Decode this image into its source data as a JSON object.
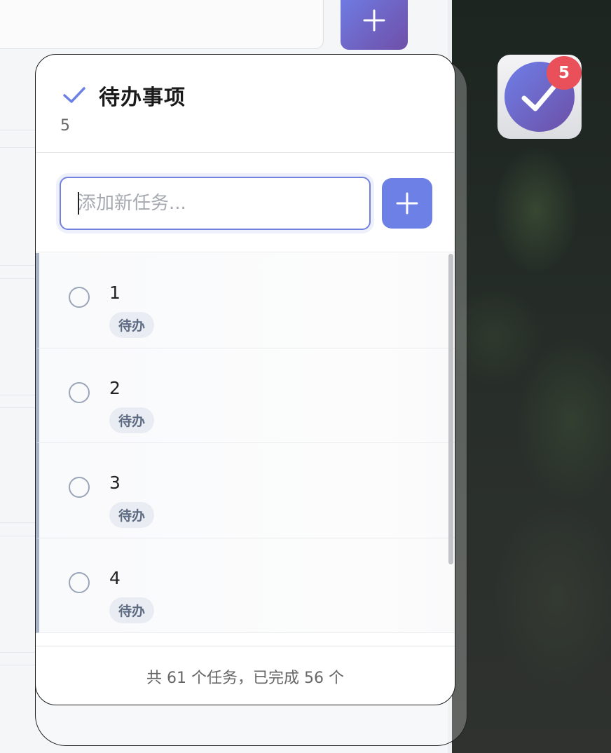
{
  "panel": {
    "title": "待办事项",
    "pending_count": "5",
    "input_placeholder": "添加新任务...",
    "add_button_symbol": "+",
    "tasks": [
      {
        "label": "1",
        "status": "待办"
      },
      {
        "label": "2",
        "status": "待办"
      },
      {
        "label": "3",
        "status": "待办"
      },
      {
        "label": "4",
        "status": "待办"
      }
    ],
    "footer": "共 61 个任务，已完成 56 个"
  },
  "widget": {
    "badge": "5",
    "icon": "check-icon"
  },
  "colors": {
    "accent": "#6c80e6",
    "gradient_end": "#6c4fa6",
    "badge": "#e9505a",
    "chip_bg": "#e9ecf2"
  }
}
